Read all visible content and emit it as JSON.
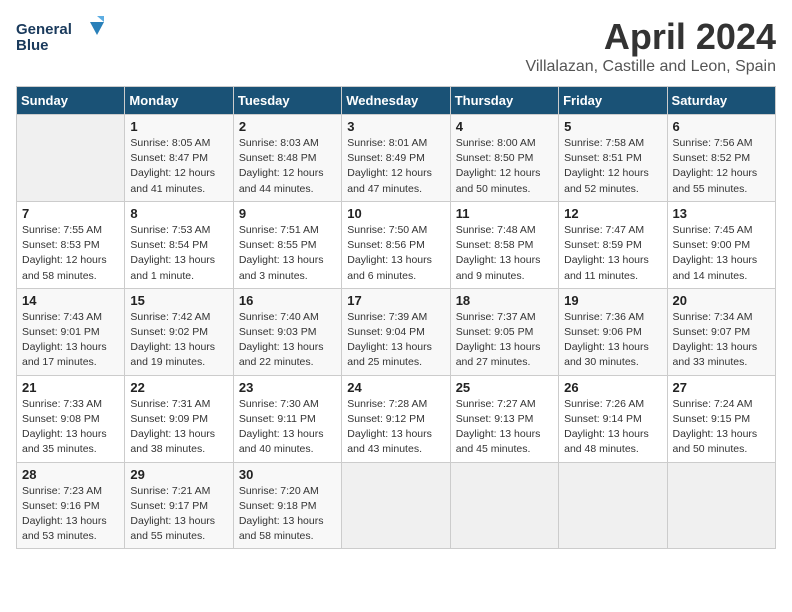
{
  "header": {
    "logo_line1": "General",
    "logo_line2": "Blue",
    "month": "April 2024",
    "location": "Villalazan, Castille and Leon, Spain"
  },
  "weekdays": [
    "Sunday",
    "Monday",
    "Tuesday",
    "Wednesday",
    "Thursday",
    "Friday",
    "Saturday"
  ],
  "weeks": [
    [
      {
        "day": "",
        "info": ""
      },
      {
        "day": "1",
        "info": "Sunrise: 8:05 AM\nSunset: 8:47 PM\nDaylight: 12 hours\nand 41 minutes."
      },
      {
        "day": "2",
        "info": "Sunrise: 8:03 AM\nSunset: 8:48 PM\nDaylight: 12 hours\nand 44 minutes."
      },
      {
        "day": "3",
        "info": "Sunrise: 8:01 AM\nSunset: 8:49 PM\nDaylight: 12 hours\nand 47 minutes."
      },
      {
        "day": "4",
        "info": "Sunrise: 8:00 AM\nSunset: 8:50 PM\nDaylight: 12 hours\nand 50 minutes."
      },
      {
        "day": "5",
        "info": "Sunrise: 7:58 AM\nSunset: 8:51 PM\nDaylight: 12 hours\nand 52 minutes."
      },
      {
        "day": "6",
        "info": "Sunrise: 7:56 AM\nSunset: 8:52 PM\nDaylight: 12 hours\nand 55 minutes."
      }
    ],
    [
      {
        "day": "7",
        "info": "Sunrise: 7:55 AM\nSunset: 8:53 PM\nDaylight: 12 hours\nand 58 minutes."
      },
      {
        "day": "8",
        "info": "Sunrise: 7:53 AM\nSunset: 8:54 PM\nDaylight: 13 hours\nand 1 minute."
      },
      {
        "day": "9",
        "info": "Sunrise: 7:51 AM\nSunset: 8:55 PM\nDaylight: 13 hours\nand 3 minutes."
      },
      {
        "day": "10",
        "info": "Sunrise: 7:50 AM\nSunset: 8:56 PM\nDaylight: 13 hours\nand 6 minutes."
      },
      {
        "day": "11",
        "info": "Sunrise: 7:48 AM\nSunset: 8:58 PM\nDaylight: 13 hours\nand 9 minutes."
      },
      {
        "day": "12",
        "info": "Sunrise: 7:47 AM\nSunset: 8:59 PM\nDaylight: 13 hours\nand 11 minutes."
      },
      {
        "day": "13",
        "info": "Sunrise: 7:45 AM\nSunset: 9:00 PM\nDaylight: 13 hours\nand 14 minutes."
      }
    ],
    [
      {
        "day": "14",
        "info": "Sunrise: 7:43 AM\nSunset: 9:01 PM\nDaylight: 13 hours\nand 17 minutes."
      },
      {
        "day": "15",
        "info": "Sunrise: 7:42 AM\nSunset: 9:02 PM\nDaylight: 13 hours\nand 19 minutes."
      },
      {
        "day": "16",
        "info": "Sunrise: 7:40 AM\nSunset: 9:03 PM\nDaylight: 13 hours\nand 22 minutes."
      },
      {
        "day": "17",
        "info": "Sunrise: 7:39 AM\nSunset: 9:04 PM\nDaylight: 13 hours\nand 25 minutes."
      },
      {
        "day": "18",
        "info": "Sunrise: 7:37 AM\nSunset: 9:05 PM\nDaylight: 13 hours\nand 27 minutes."
      },
      {
        "day": "19",
        "info": "Sunrise: 7:36 AM\nSunset: 9:06 PM\nDaylight: 13 hours\nand 30 minutes."
      },
      {
        "day": "20",
        "info": "Sunrise: 7:34 AM\nSunset: 9:07 PM\nDaylight: 13 hours\nand 33 minutes."
      }
    ],
    [
      {
        "day": "21",
        "info": "Sunrise: 7:33 AM\nSunset: 9:08 PM\nDaylight: 13 hours\nand 35 minutes."
      },
      {
        "day": "22",
        "info": "Sunrise: 7:31 AM\nSunset: 9:09 PM\nDaylight: 13 hours\nand 38 minutes."
      },
      {
        "day": "23",
        "info": "Sunrise: 7:30 AM\nSunset: 9:11 PM\nDaylight: 13 hours\nand 40 minutes."
      },
      {
        "day": "24",
        "info": "Sunrise: 7:28 AM\nSunset: 9:12 PM\nDaylight: 13 hours\nand 43 minutes."
      },
      {
        "day": "25",
        "info": "Sunrise: 7:27 AM\nSunset: 9:13 PM\nDaylight: 13 hours\nand 45 minutes."
      },
      {
        "day": "26",
        "info": "Sunrise: 7:26 AM\nSunset: 9:14 PM\nDaylight: 13 hours\nand 48 minutes."
      },
      {
        "day": "27",
        "info": "Sunrise: 7:24 AM\nSunset: 9:15 PM\nDaylight: 13 hours\nand 50 minutes."
      }
    ],
    [
      {
        "day": "28",
        "info": "Sunrise: 7:23 AM\nSunset: 9:16 PM\nDaylight: 13 hours\nand 53 minutes."
      },
      {
        "day": "29",
        "info": "Sunrise: 7:21 AM\nSunset: 9:17 PM\nDaylight: 13 hours\nand 55 minutes."
      },
      {
        "day": "30",
        "info": "Sunrise: 7:20 AM\nSunset: 9:18 PM\nDaylight: 13 hours\nand 58 minutes."
      },
      {
        "day": "",
        "info": ""
      },
      {
        "day": "",
        "info": ""
      },
      {
        "day": "",
        "info": ""
      },
      {
        "day": "",
        "info": ""
      }
    ]
  ]
}
